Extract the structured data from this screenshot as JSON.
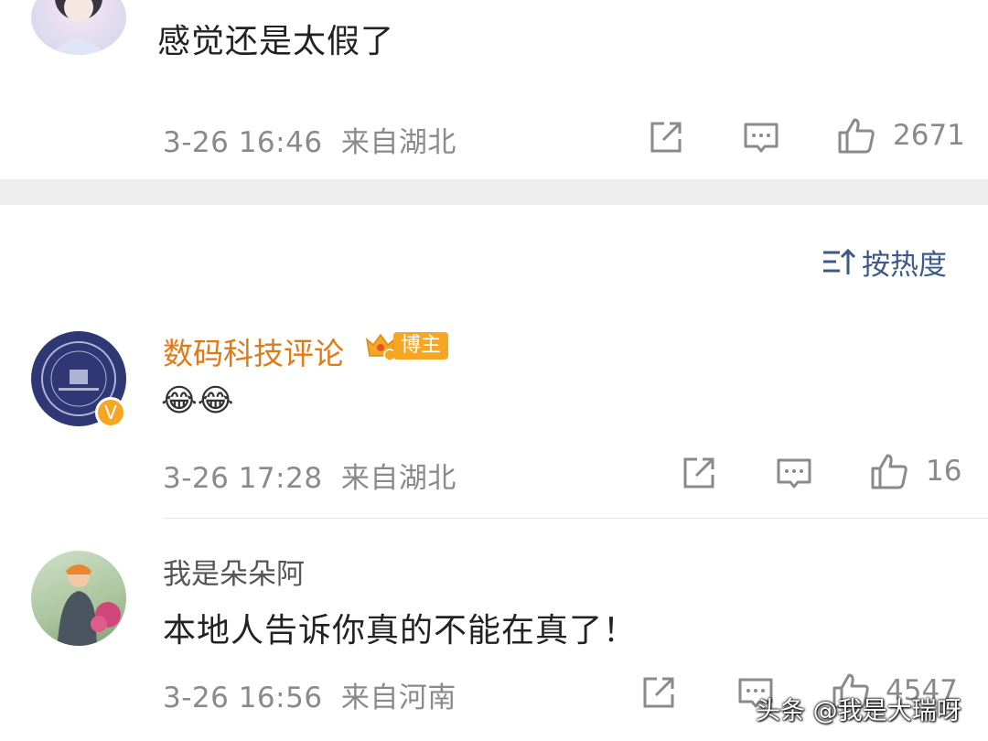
{
  "comments": [
    {
      "text": "感觉还是太假了",
      "time": "3-26 16:46",
      "location": "来自湖北",
      "likes": "2671"
    },
    {
      "username": "数码科技评论",
      "badge": "博主",
      "text": "😂😂",
      "time": "3-26 17:28",
      "location": "来自湖北",
      "likes": "16"
    },
    {
      "username": "我是朵朵阿",
      "text": "本地人告诉你真的不能在真了！",
      "time": "3-26 16:56",
      "location": "来自河南",
      "likes": "4547"
    }
  ],
  "sort": {
    "label": "按热度"
  },
  "watermark": "头条 @我是大瑞呀",
  "colors": {
    "blogger_name": "#e07a16",
    "sort_link": "#3b5a8a",
    "meta": "#8a8a8a",
    "band": "#eeeeee"
  },
  "icons": [
    "repost-icon",
    "comment-icon",
    "like-icon",
    "sort-icon",
    "crown-badge-icon",
    "verified-v-icon"
  ]
}
